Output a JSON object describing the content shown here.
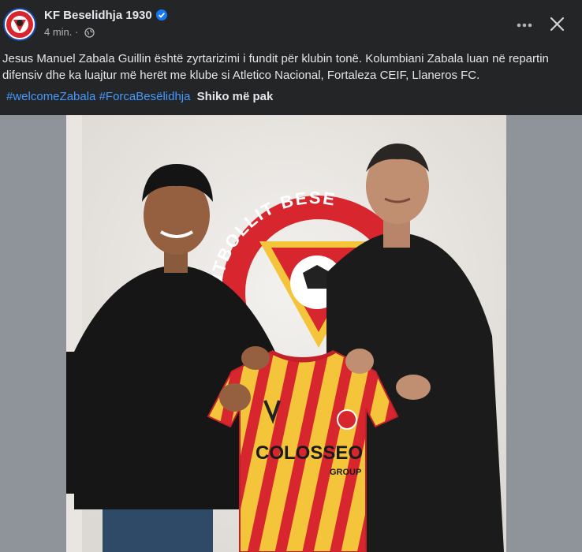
{
  "post": {
    "page_name": "KF Beselidhja 1930",
    "time": "4 min.",
    "separator": "·",
    "text": "Jesus Manuel Zabala Guillin është zyrtarizimi i fundit për klubin tonë. Kolumbiani Zabala luan në repartin difensiv dhe ka luajtur më herët me klube si   Atletico Nacional, Fortaleza CEIF, Llaneros FC.",
    "hashtags": [
      "#welcomeZabala",
      "#ForcaBesëlidhja"
    ],
    "see_more": "Shiko më pak",
    "verified_icon": "verified-badge-icon",
    "audience_icon": "globe-icon"
  },
  "photo": {
    "wall_logo_text": "KLUBI FUTBOLLIT BESE",
    "jersey_sponsor": "COLOSSEO",
    "jersey_sponsor_sub": "GROUP"
  },
  "colors": {
    "background": "#242526",
    "hashtag": "#4599ff",
    "jersey_red": "#d7262e",
    "jersey_yellow": "#f4c53a"
  }
}
